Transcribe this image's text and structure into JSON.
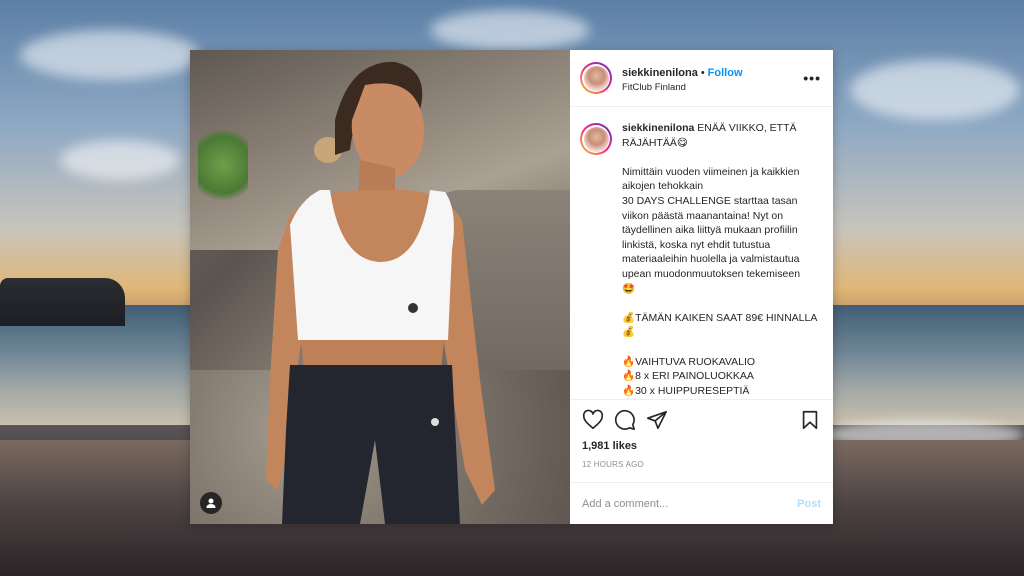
{
  "post": {
    "username": "siekkinenilona",
    "follow_label": "Follow",
    "separator": "•",
    "location": "FitClub Finland",
    "more_label": "•••",
    "caption": {
      "username": "siekkinenilona",
      "text": " ENÄÄ VIIKKO, ETTÄ RÄJÄHTÄÄ😋\n\nNimittäin vuoden viimeinen ja kaikkien aikojen tehokkain\n30 DAYS CHALLENGE starttaa tasan viikon päästä maanantaina! Nyt on täydellinen aika liittyä mukaan profiilin linkistä, koska nyt ehdit tutustua materiaaleihin huolella ja valmistautua upean muodonmuutoksen tekemiseen\n🤩\n\n💰TÄMÄN KAIKEN SAAT 89€ HINNALLA💰\n\n🔥VAIHTUVA RUOKAVALIO\n🔥8 x ERI PAINOLUOKKAA\n🔥30 x HUIPPURESEPTIÄ\n🔥RUOKAVALIOT ERI TAVOITTEISIIN"
    },
    "likes": "1,981 likes",
    "time": "12 HOURS AGO",
    "comment_placeholder": "Add a comment...",
    "post_label": "Post",
    "icons": {
      "like": "heart-icon",
      "comment": "comment-icon",
      "share": "paper-plane-icon",
      "save": "bookmark-icon",
      "tag": "user-tag-icon"
    },
    "colors": {
      "follow": "#0095f6",
      "post_disabled": "#b2dffc",
      "text": "#262626",
      "muted": "#8e8e8e"
    }
  }
}
